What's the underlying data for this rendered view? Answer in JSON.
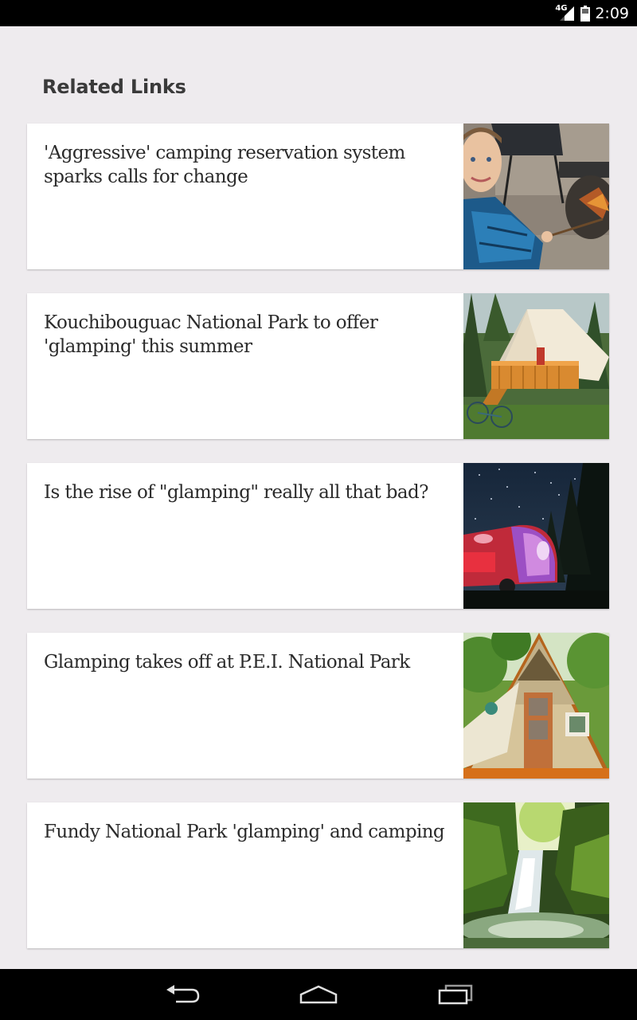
{
  "status_bar": {
    "network_label": "4G",
    "time": "2:09",
    "icons": [
      "signal-icon",
      "battery-icon"
    ]
  },
  "section": {
    "title": "Related Links"
  },
  "links": [
    {
      "title": "'Aggressive' camping reservation system sparks calls for change",
      "thumbnail": "boy-at-campfire-photo"
    },
    {
      "title": "Kouchibouguac National Park to offer 'glamping' this summer",
      "thumbnail": "canvas-tent-cabin-photo"
    },
    {
      "title": "Is the rise of \"glamping\" really all that bad?",
      "thumbnail": "camper-under-stars-photo"
    },
    {
      "title": "Glamping takes off at P.E.I. National Park",
      "thumbnail": "a-frame-tent-photo"
    },
    {
      "title": "Fundy National Park 'glamping' and camping",
      "thumbnail": "waterfall-forest-photo"
    }
  ],
  "nav_bar": {
    "buttons": [
      "back-icon",
      "home-icon",
      "recent-apps-icon"
    ]
  }
}
